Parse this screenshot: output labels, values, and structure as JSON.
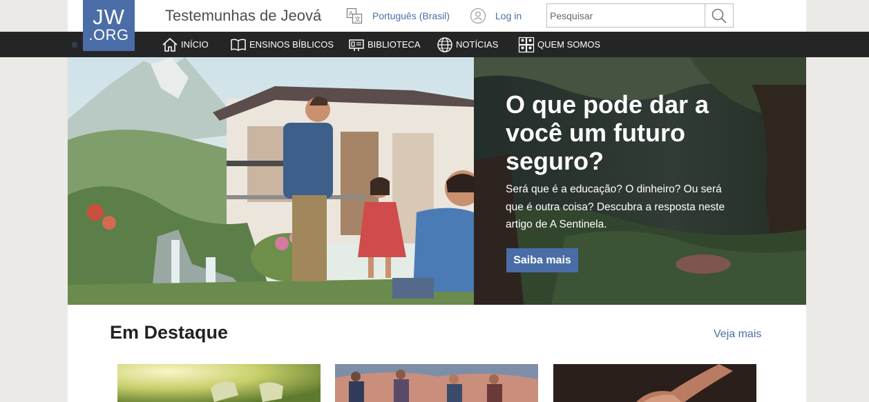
{
  "header": {
    "logo_line1": "JW",
    "logo_line2": ".ORG",
    "registered_mark": "®",
    "site_title": "Testemunhas de Jeová",
    "language_label": "Português (Brasil)",
    "login_label": "Log in",
    "search_placeholder": "Pesquisar"
  },
  "nav": {
    "items": [
      {
        "label": "INÍCIO",
        "icon": "home-icon"
      },
      {
        "label": "ENSINOS BÍBLICOS",
        "icon": "open-book-icon"
      },
      {
        "label": "BIBLIOTECA",
        "icon": "library-icon"
      },
      {
        "label": "NOTÍCIAS",
        "icon": "globe-icon"
      },
      {
        "label": "QUEM SOMOS",
        "icon": "people-icon"
      }
    ]
  },
  "hero": {
    "title": "O que pode dar a você um futuro seguro?",
    "description": "Será que é a educação? O dinheiro? Ou será que é outra coisa? Descubra a resposta neste artigo de A Sentinela.",
    "button_label": "Saiba mais"
  },
  "featured": {
    "title": "Em Destaque",
    "more_label": "Veja mais"
  },
  "colors": {
    "brand_blue": "#4a6da7",
    "nav_background": "#252526",
    "page_background": "#ebeae6"
  }
}
